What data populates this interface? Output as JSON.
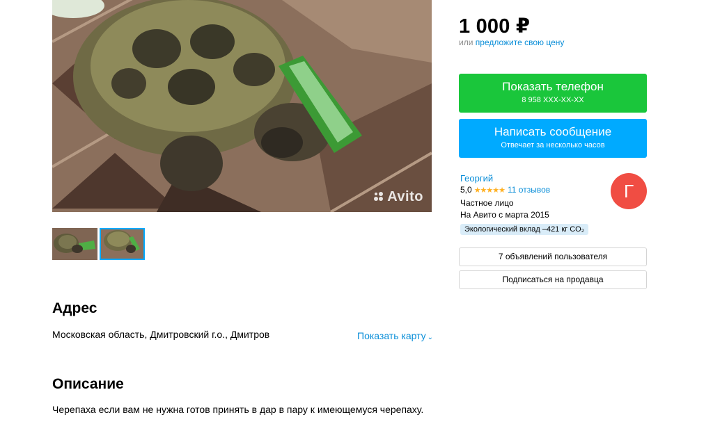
{
  "gallery": {
    "watermark": "Avito",
    "thumbnails": [
      "photo-1",
      "photo-2"
    ],
    "active_thumbnail": 2
  },
  "listing": {
    "price": "1 000 ₽",
    "offer_prefix": "или",
    "offer_link": "предложите свою цену"
  },
  "actions": {
    "phone_label": "Показать телефон",
    "phone_number": "8 958 XXX-XX-XX",
    "message_label": "Написать сообщение",
    "message_sub": "Отвечает за несколько часов"
  },
  "seller": {
    "name": "Георгий",
    "rating": "5,0",
    "stars": "★★★★★",
    "reviews": "11 отзывов",
    "type": "Частное лицо",
    "since": "На Авито с марта 2015",
    "eco": "Экологический вклад –421 кг CO₂",
    "avatar_letter": "Г",
    "avatar_color": "#f04d43",
    "ads_button": "7 объявлений пользователя",
    "subscribe_button": "Подписаться на продавца"
  },
  "address": {
    "title": "Адрес",
    "text": "Московская область, Дмитровский г.о., Дмитров",
    "map_link": "Показать карту"
  },
  "description": {
    "title": "Описание",
    "text": "Черепаха если вам не нужна готов принять в дар в пару к имеющемуся черепаху."
  },
  "colors": {
    "phone_button": "#1ac63b",
    "message_button": "#00aaff",
    "link": "#0a8ed8",
    "stars": "#ffb021"
  }
}
